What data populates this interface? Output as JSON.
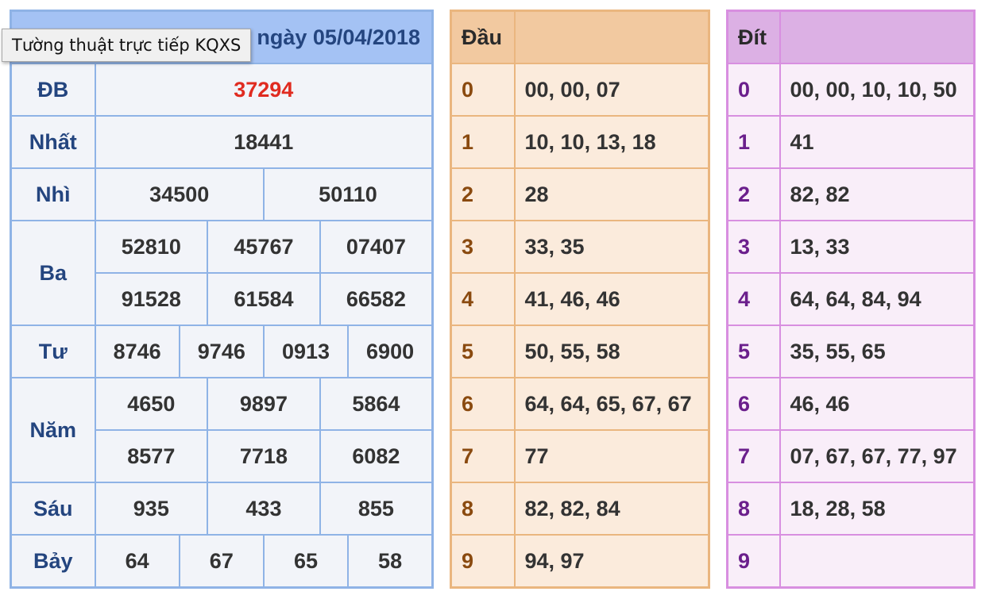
{
  "results": {
    "title": "Xổ số miền Bắc Thứ Năm ngày 05/04/2018",
    "title_visible": "ngày 05/04/2018",
    "tooltip": "Tường thuật trực tiếp KQXS",
    "prizes": {
      "db": {
        "label": "ĐB",
        "values": [
          "37294"
        ]
      },
      "nhat": {
        "label": "Nhất",
        "values": [
          "18441"
        ]
      },
      "nhi": {
        "label": "Nhì",
        "values": [
          "34500",
          "50110"
        ]
      },
      "ba": {
        "label": "Ba",
        "values": [
          "52810",
          "45767",
          "07407",
          "91528",
          "61584",
          "66582"
        ]
      },
      "tu": {
        "label": "Tư",
        "values": [
          "8746",
          "9746",
          "0913",
          "6900"
        ]
      },
      "nam": {
        "label": "Năm",
        "values": [
          "4650",
          "9897",
          "5864",
          "8577",
          "7718",
          "6082"
        ]
      },
      "sau": {
        "label": "Sáu",
        "values": [
          "935",
          "433",
          "855"
        ]
      },
      "bay": {
        "label": "Bảy",
        "values": [
          "64",
          "67",
          "65",
          "58"
        ]
      }
    }
  },
  "dau": {
    "header": "Đầu",
    "rows": [
      {
        "k": "0",
        "v": "00, 00, 07"
      },
      {
        "k": "1",
        "v": "10, 10, 13, 18"
      },
      {
        "k": "2",
        "v": "28"
      },
      {
        "k": "3",
        "v": "33, 35"
      },
      {
        "k": "4",
        "v": "41, 46, 46"
      },
      {
        "k": "5",
        "v": "50, 55, 58"
      },
      {
        "k": "6",
        "v": "64, 64, 65, 67, 67"
      },
      {
        "k": "7",
        "v": "77"
      },
      {
        "k": "8",
        "v": "82, 82, 84"
      },
      {
        "k": "9",
        "v": "94, 97"
      }
    ]
  },
  "dit": {
    "header": "Đít",
    "rows": [
      {
        "k": "0",
        "v": "00, 00, 10, 10, 50"
      },
      {
        "k": "1",
        "v": "41"
      },
      {
        "k": "2",
        "v": "82, 82"
      },
      {
        "k": "3",
        "v": "13, 33"
      },
      {
        "k": "4",
        "v": "64, 64, 84, 94"
      },
      {
        "k": "5",
        "v": "35, 55, 65"
      },
      {
        "k": "6",
        "v": "46, 46"
      },
      {
        "k": "7",
        "v": "07, 67, 67, 77, 97"
      },
      {
        "k": "8",
        "v": "18, 28, 58"
      },
      {
        "k": "9",
        "v": ""
      }
    ]
  },
  "colors": {
    "special_prize": "#e02b20",
    "kq_header": "#a4c2f4",
    "dau_header": "#f2c9a0",
    "dit_header": "#dcb0e4"
  }
}
